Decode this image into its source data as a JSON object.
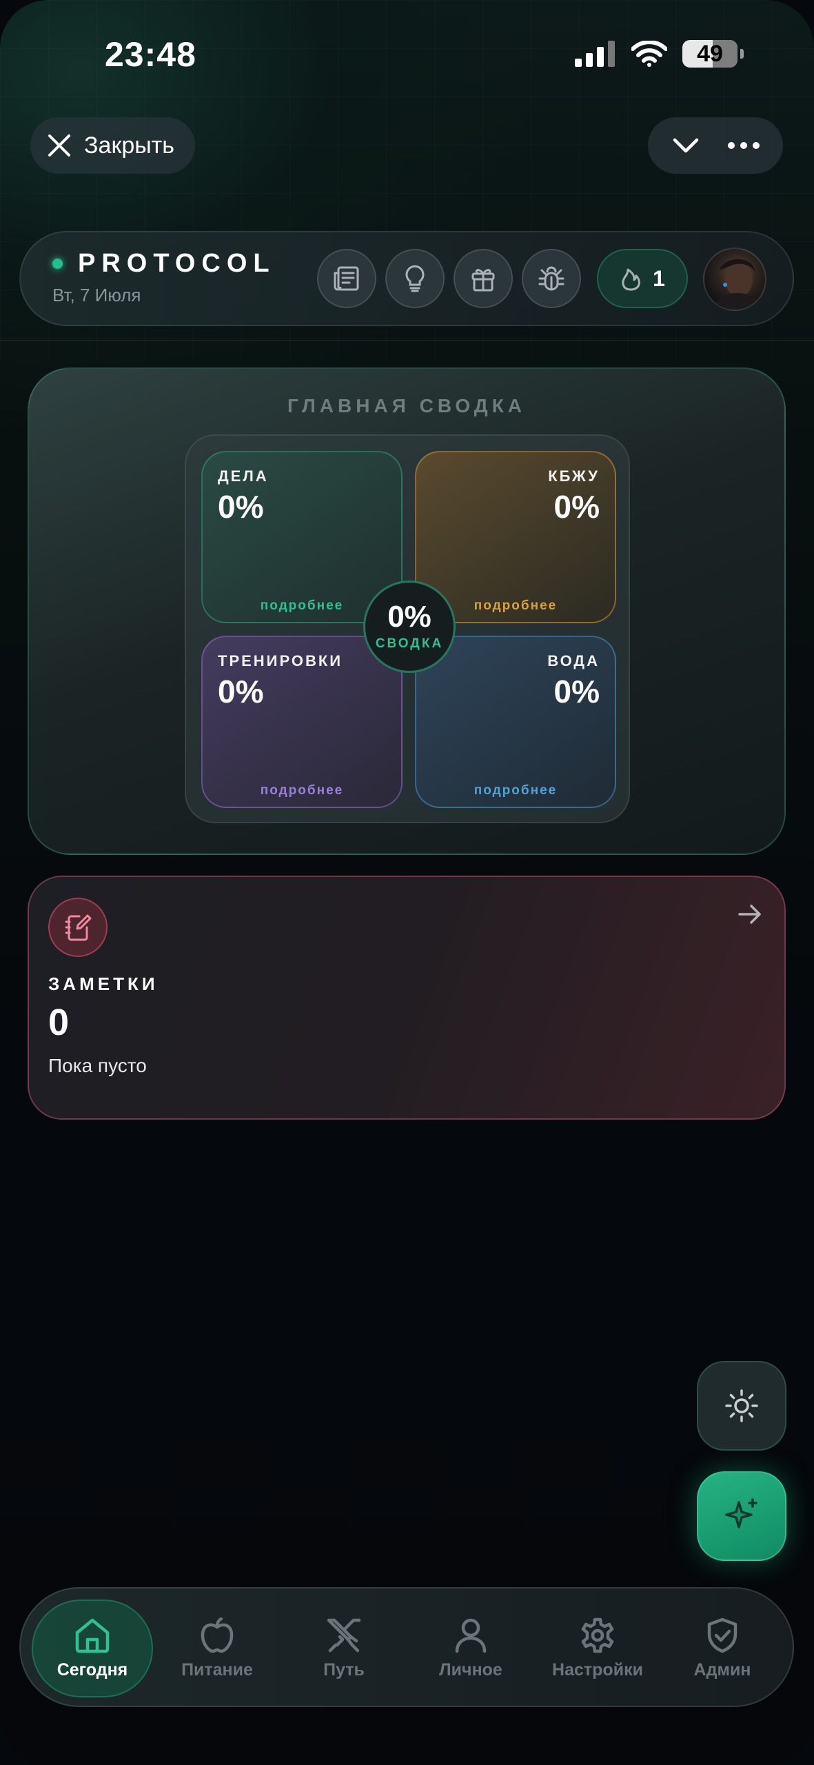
{
  "status_bar": {
    "time": "23:48",
    "battery": "49",
    "battery_level": 0.49
  },
  "top_bar": {
    "close_label": "Закрыть"
  },
  "header": {
    "brand": "PROTOCOL",
    "date": "Вт, 7 Июля",
    "streak": "1"
  },
  "summary": {
    "title": "ГЛАВНАЯ СВОДКА",
    "center_value": "0%",
    "center_label": "СВОДКА",
    "tiles": [
      {
        "label": "ДЕЛА",
        "value": "0%",
        "more": "подробнее",
        "color": "#2ec28f"
      },
      {
        "label": "КБЖУ",
        "value": "0%",
        "more": "подробнее",
        "color": "#d9a23a"
      },
      {
        "label": "ТРЕНИРОВКИ",
        "value": "0%",
        "more": "подробнее",
        "color": "#9a80d8"
      },
      {
        "label": "ВОДА",
        "value": "0%",
        "more": "подробнее",
        "color": "#4fa3d8"
      }
    ]
  },
  "notes": {
    "label": "ЗАМЕТКИ",
    "count": "0",
    "empty_text": "Пока пусто"
  },
  "nav": {
    "items": [
      {
        "label": "Сегодня",
        "icon": "home-icon",
        "active": true
      },
      {
        "label": "Питание",
        "icon": "apple-icon"
      },
      {
        "label": "Путь",
        "icon": "swords-icon"
      },
      {
        "label": "Личное",
        "icon": "user-icon"
      },
      {
        "label": "Настройки",
        "icon": "gear-icon"
      },
      {
        "label": "Админ",
        "icon": "shield-check-icon"
      }
    ]
  },
  "colors": {
    "accent": "#22c08b",
    "notes_accent": "#d0566e"
  }
}
